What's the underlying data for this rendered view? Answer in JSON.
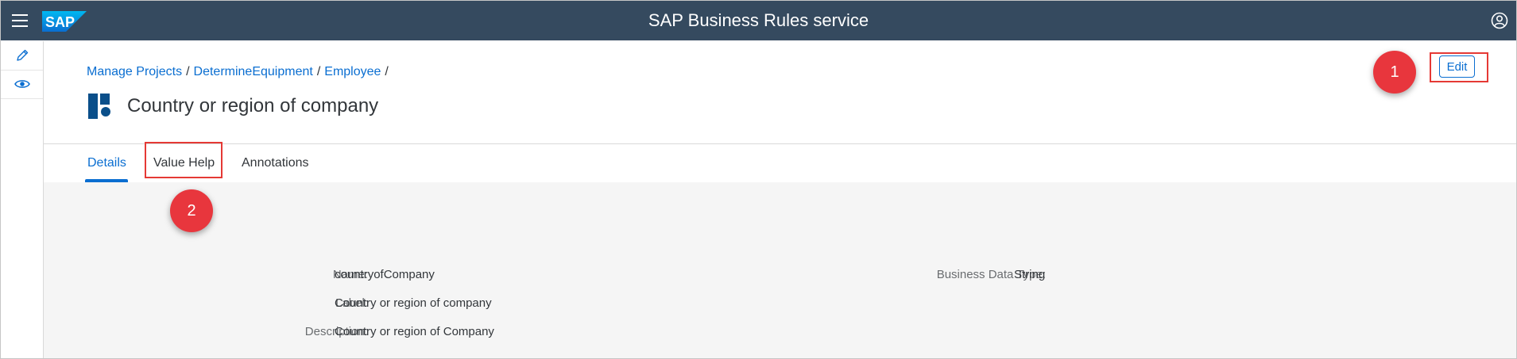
{
  "shell": {
    "title": "SAP Business Rules service",
    "logo_text": "SAP"
  },
  "rail": {
    "items": [
      {
        "icon": "pencil-icon"
      },
      {
        "icon": "eye-icon"
      }
    ]
  },
  "breadcrumb": {
    "items": [
      "Manage Projects",
      "DetermineEquipment",
      "Employee"
    ],
    "separator": "/"
  },
  "header": {
    "title": "Country or region of company",
    "edit_label": "Edit"
  },
  "annotations": {
    "badge1": "1",
    "badge2": "2"
  },
  "tabs": [
    {
      "label": "Details",
      "selected": true
    },
    {
      "label": "Value Help",
      "selected": false
    },
    {
      "label": "Annotations",
      "selected": false
    }
  ],
  "details": {
    "name_label": "Name:",
    "name_value": "countryofCompany",
    "label_label": "Label:",
    "label_value": "Country or region of company",
    "description_label": "Description:",
    "description_value": "Country or region of Company",
    "bdt_label": "Business Data Type:",
    "bdt_value": "String"
  },
  "colors": {
    "shell": "#354a5f",
    "accent": "#0a6ed1",
    "highlight": "#e53935",
    "badge": "#e8363d"
  }
}
